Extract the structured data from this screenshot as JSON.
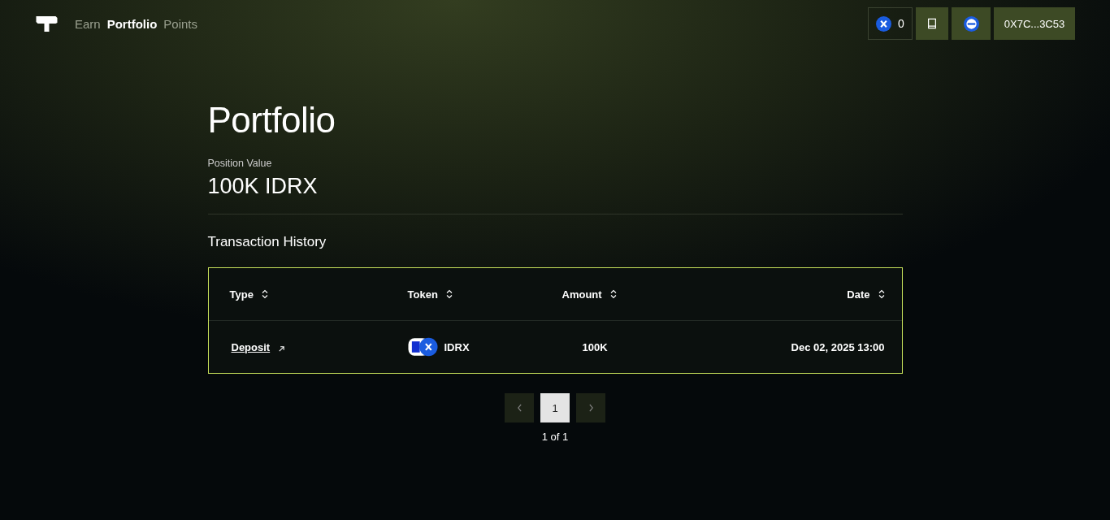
{
  "nav": {
    "items": [
      {
        "label": "Earn",
        "selected": false
      },
      {
        "label": "Portfolio",
        "selected": true
      },
      {
        "label": "Points",
        "selected": false
      }
    ]
  },
  "header": {
    "points": "0",
    "wallet": "0X7C...3C53"
  },
  "page": {
    "title": "Portfolio",
    "position_label": "Position Value",
    "position_value": "100K IDRX",
    "history_title": "Transaction History"
  },
  "table": {
    "columns": [
      {
        "label": "Type"
      },
      {
        "label": "Token"
      },
      {
        "label": "Amount"
      },
      {
        "label": "Date"
      }
    ],
    "rows": [
      {
        "type": "Deposit",
        "token": "IDRX",
        "amount": "100K",
        "date": "Dec 02, 2025 13:00"
      }
    ]
  },
  "pagination": {
    "pages": [
      {
        "label": "1",
        "selected": true
      }
    ],
    "summary": "1 of 1"
  }
}
